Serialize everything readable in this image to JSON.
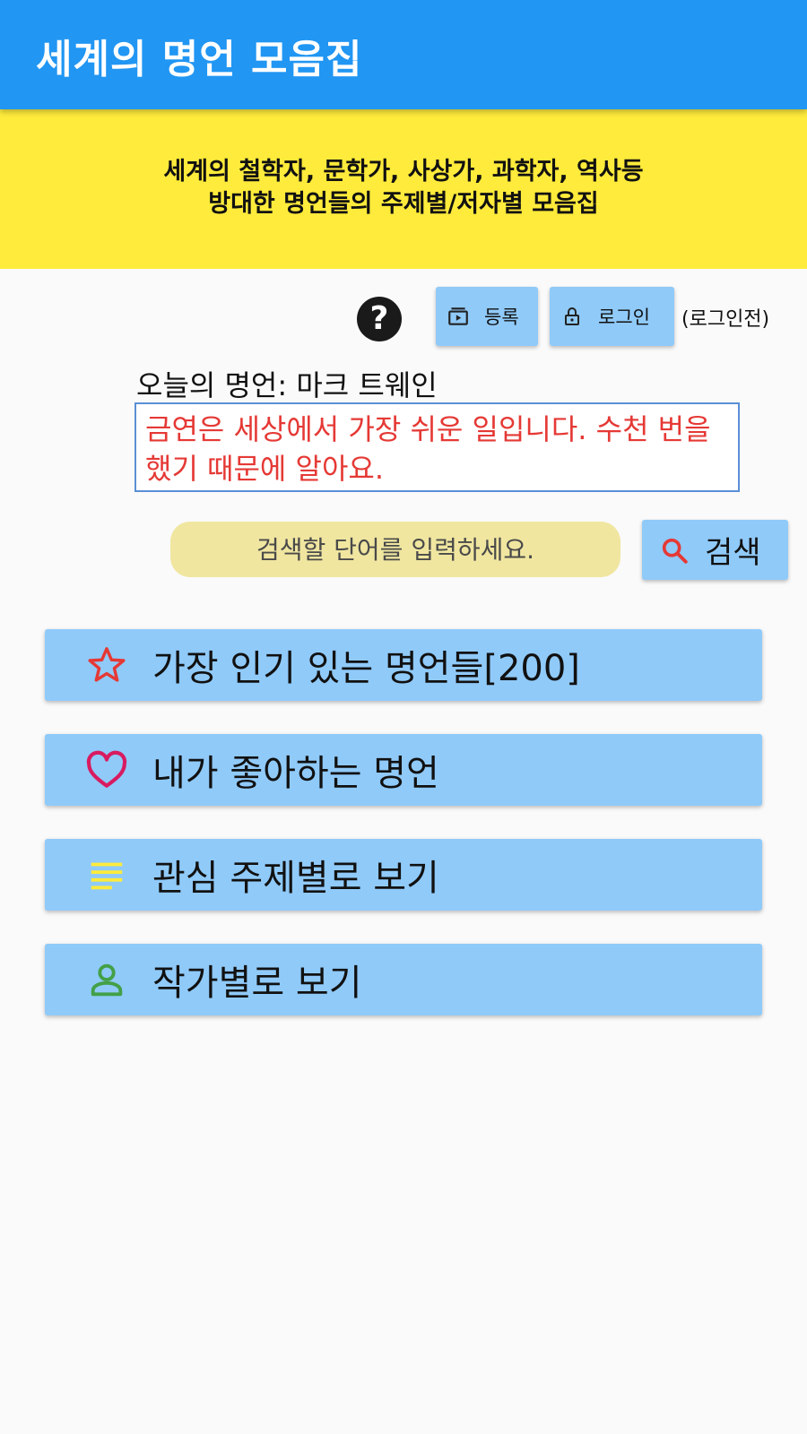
{
  "app": {
    "title": "세계의 명언 모음집"
  },
  "banner": {
    "line1": "세계의 철학자, 문학가, 사상가, 과학자, 역사등",
    "line2": "방대한 명언들의 주제별/저자별 모음집"
  },
  "toolbar": {
    "help_icon": "?",
    "register_label": "등록",
    "login_label": "로그인",
    "login_state": "(로그인전)"
  },
  "today": {
    "label": "오늘의 명언: 마크 트웨인",
    "quote": "금연은 세상에서 가장 쉬운 일입니다. 수천 번을 했기 때문에 알아요."
  },
  "search": {
    "placeholder": "검색할 단어를 입력하세요.",
    "button_label": "검색"
  },
  "menu": [
    {
      "label": "가장 인기 있는 명언들[200]",
      "icon": "star-outline-icon",
      "color": "#e53935"
    },
    {
      "label": "내가 좋아하는 명언",
      "icon": "heart-outline-icon",
      "color": "#d81b60"
    },
    {
      "label": "관심 주제별로 보기",
      "icon": "list-lines-icon",
      "color": "#ffeb3b"
    },
    {
      "label": "작가별로 보기",
      "icon": "person-outline-icon",
      "color": "#43a047"
    }
  ],
  "colors": {
    "appbar": "#2196f3",
    "banner": "#ffeb3b",
    "button": "#90caf9",
    "quote_text": "#e53935",
    "search_bg": "#f0e6a0"
  }
}
